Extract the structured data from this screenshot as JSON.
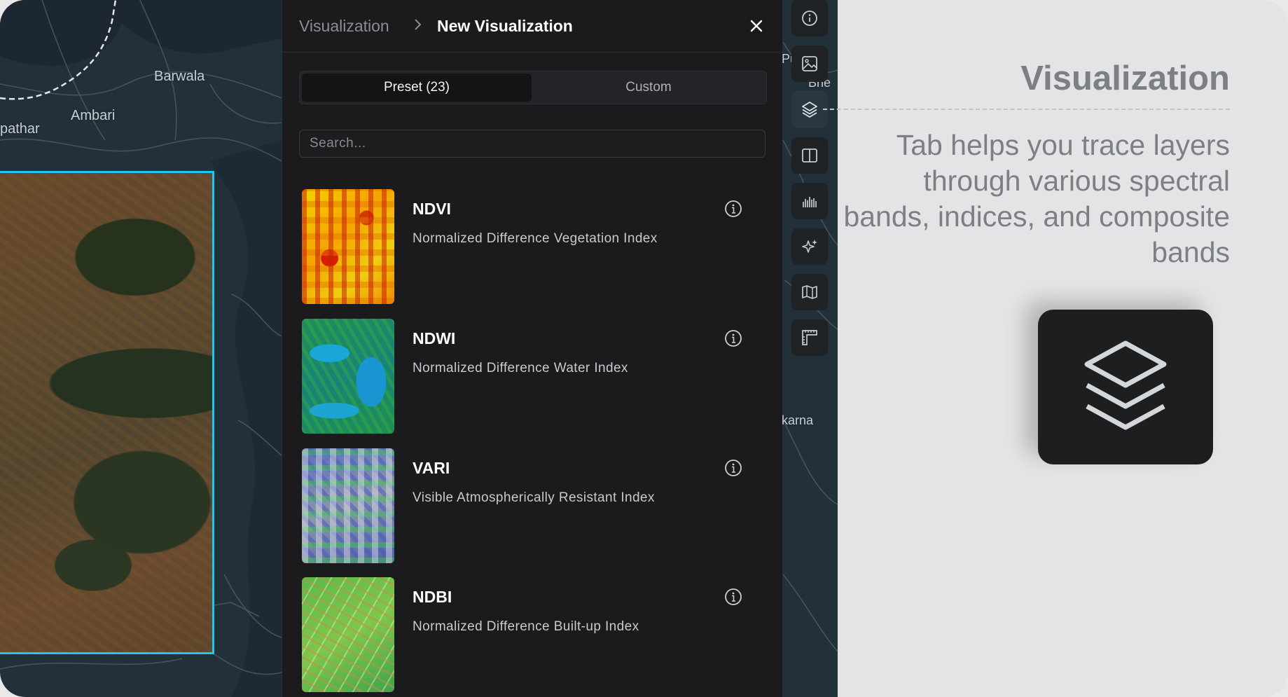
{
  "map": {
    "labels": [
      "Barwala",
      "Ambari",
      "pathar",
      "Bhe",
      "karna",
      "Pu"
    ]
  },
  "panel": {
    "breadcrumb_parent": "Visualization",
    "breadcrumb_separator": ">",
    "breadcrumb_current": "New Visualization",
    "close_icon": "close-icon",
    "tabs": [
      {
        "label": "Preset (23)",
        "active": true
      },
      {
        "label": "Custom",
        "active": false
      }
    ],
    "search_placeholder": "Search...",
    "items": [
      {
        "title": "NDVI",
        "description": "Normalized Difference Vegetation Index",
        "icon": "info-icon"
      },
      {
        "title": "NDWI",
        "description": "Normalized Difference Water Index",
        "icon": "info-icon"
      },
      {
        "title": "VARI",
        "description": "Visible Atmospherically Resistant Index",
        "icon": "info-icon"
      },
      {
        "title": "NDBI",
        "description": "Normalized Difference Built-up Index",
        "icon": "info-icon"
      }
    ]
  },
  "toolbar": {
    "tools": [
      "info-icon",
      "image-icon",
      "layers-icon",
      "split-view-icon",
      "histogram-icon",
      "sparkle-icon",
      "map-icon",
      "ruler-icon"
    ],
    "active_tool": "layers-icon"
  },
  "side": {
    "title": "Visualization",
    "description": "Tab helps you trace layers through various spectral bands, indices, and composite bands",
    "feature_icon": "layers-icon"
  },
  "colors": {
    "aoi_border": "#22c4f0",
    "panel_bg": "#1b1b1e",
    "side_bg": "#e3e4e6",
    "side_text": "#7c7f84"
  }
}
